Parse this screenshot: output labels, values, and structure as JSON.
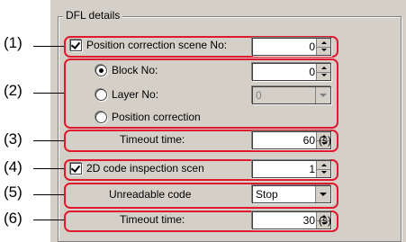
{
  "group": {
    "title": "DFL details"
  },
  "annotations": [
    "(1)",
    "(2)",
    "(3)",
    "(4)",
    "(5)",
    "(6)"
  ],
  "position_correction": {
    "label": "Position correction scene No:",
    "checked": true,
    "value": "0"
  },
  "block": {
    "label": "Block No:",
    "selected": true,
    "value": "0"
  },
  "layer": {
    "label": "Layer No:",
    "selected": false,
    "value": "0",
    "disabled": true
  },
  "position_correction_option": {
    "label": "Position correction",
    "selected": false
  },
  "timeout1": {
    "label": "Timeout time:",
    "value": "60",
    "unit": "(s)"
  },
  "code2d": {
    "label": "2D code inspection scen",
    "checked": true,
    "value": "1"
  },
  "unreadable": {
    "label": "Unreadable code",
    "value": "Stop"
  },
  "timeout2": {
    "label": "Timeout time:",
    "value": "30",
    "unit": "(s)"
  },
  "colors": {
    "highlight": "#e0192f",
    "dialog_bg": "#d4d0c8"
  }
}
